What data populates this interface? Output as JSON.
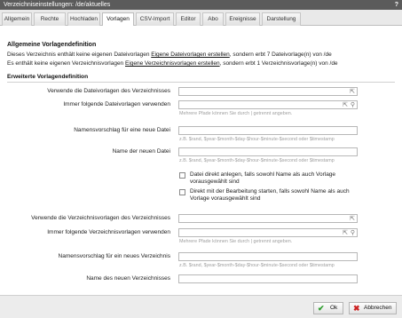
{
  "window": {
    "title": "Verzeichniseinstellungen: /de/aktuelles",
    "help": "?"
  },
  "tabs": [
    "Allgemein",
    "Rechte",
    "Hochladen",
    "Vorlagen",
    "CSV-Import",
    "Editor",
    "Abo",
    "Ereignisse",
    "Darstellung"
  ],
  "active_tab": "Vorlagen",
  "general": {
    "heading": "Allgemeine Vorlagendefinition",
    "line1_pre": "Dieses Verzeichnis enthält keine eigenen Dateivorlagen",
    "line1_link": "Eigene Dateivorlagen erstellen",
    "line1_post": ", sondern erbt 7 Dateivorlage(n) von /de",
    "line2_pre": "Es enthält keine eigenen Verzeichnisvorlagen",
    "line2_link": "Eigene Verzeichnisvorlagen erstellen",
    "line2_post": ", sondern erbt 1 Verzeichnisvorlage(n) von /de"
  },
  "extended": {
    "heading": "Erweiterte Vorlagendefinition",
    "file_template_label": "Verwende die Dateivorlagen des Verzeichnisses",
    "always_file_label": "Immer folgende Dateivorlagen verwenden",
    "always_file_hint": "Mehrere Pfade können Sie durch | getrennt angeben.",
    "file_name_suggestion_label": "Namensvorschlag für eine neue Datei",
    "file_name_suggestion_hint": "z.B. $rand, $year-$month-$day-$hour-$minute-$second oder $timestamp",
    "new_file_name_label": "Name der neuen Datei",
    "new_file_name_hint": "z.B. $rand, $year-$month-$day-$hour-$minute-$second oder $timestamp",
    "checkbox_create": "Datei direkt anlegen, falls sowohl Name als auch Vorlage vorausgewählt sind",
    "checkbox_edit": "Direkt mit der Bearbeitung starten, falls sowohl Name als auch Vorlage vorausgewählt sind",
    "dir_template_label": "Verwende die Verzeichnisvorlagen des Verzeichnisses",
    "always_dir_label": "Immer folgende Verzeichnisvorlagen verwenden",
    "always_dir_hint": "Mehrere Pfade können Sie durch | getrennt angeben.",
    "dir_name_suggestion_label": "Namensvorschlag für ein neues Verzeichnis",
    "dir_name_suggestion_hint": "z.B. $rand, $year-$month-$day-$hour-$minute-$second oder $timestamp",
    "new_dir_name_label": "Name des neuen Verzeichnisses"
  },
  "buttons": {
    "ok": "Ok",
    "cancel": "Abbrechen"
  },
  "colors": {
    "titlebar": "#5b5b5b",
    "ok_icon": "#2e9e2e",
    "cancel_icon": "#cc2222"
  },
  "icons": {
    "folder_picker": "cursor-icon",
    "search": "search-icon",
    "ok": "check-icon",
    "cancel": "x-icon"
  }
}
